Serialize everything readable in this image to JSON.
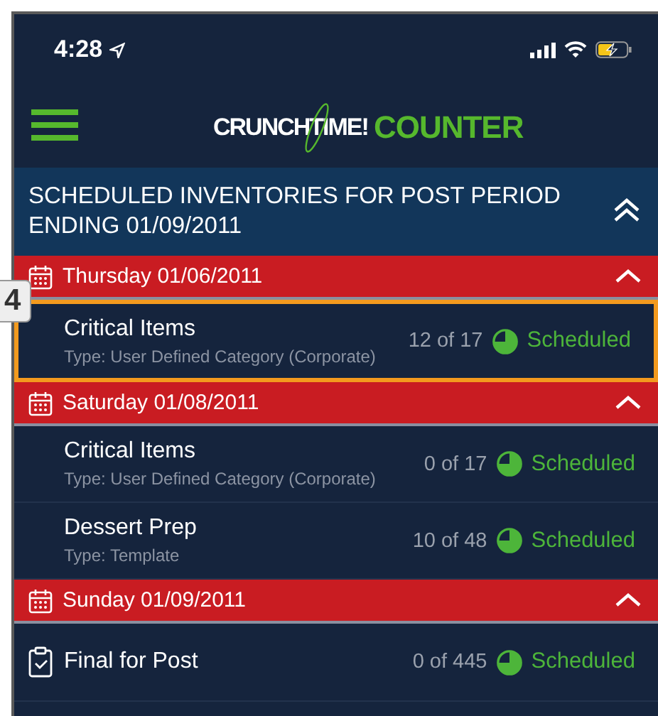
{
  "status_bar": {
    "time": "4:28"
  },
  "header": {
    "logo_left": "CRUNCHTIME!",
    "logo_right": "COUNTER"
  },
  "section": {
    "title": "SCHEDULED INVENTORIES FOR POST PERIOD ENDING 01/09/2011",
    "expanded": true
  },
  "days": [
    {
      "date": "Thursday 01/06/2011",
      "expanded": true,
      "items": [
        {
          "kind": "plain",
          "name": "Critical Items",
          "type": "Type: User Defined Category (Corporate)",
          "count": "12 of 17",
          "status": "Scheduled",
          "highlighted": true
        }
      ]
    },
    {
      "date": "Saturday 01/08/2011",
      "expanded": true,
      "items": [
        {
          "kind": "plain",
          "name": "Critical Items",
          "type": "Type: User Defined Category (Corporate)",
          "count": "0 of 17",
          "status": "Scheduled",
          "highlighted": false
        },
        {
          "kind": "plain",
          "name": "Dessert Prep",
          "type": "Type: Template",
          "count": "10 of 48",
          "status": "Scheduled",
          "highlighted": false
        }
      ]
    },
    {
      "date": "Sunday 01/09/2011",
      "expanded": true,
      "items": [
        {
          "kind": "checklist",
          "name": "Final for Post",
          "count": "0 of 445",
          "status": "Scheduled",
          "highlighted": false
        }
      ]
    }
  ],
  "callout": {
    "label": "4"
  }
}
